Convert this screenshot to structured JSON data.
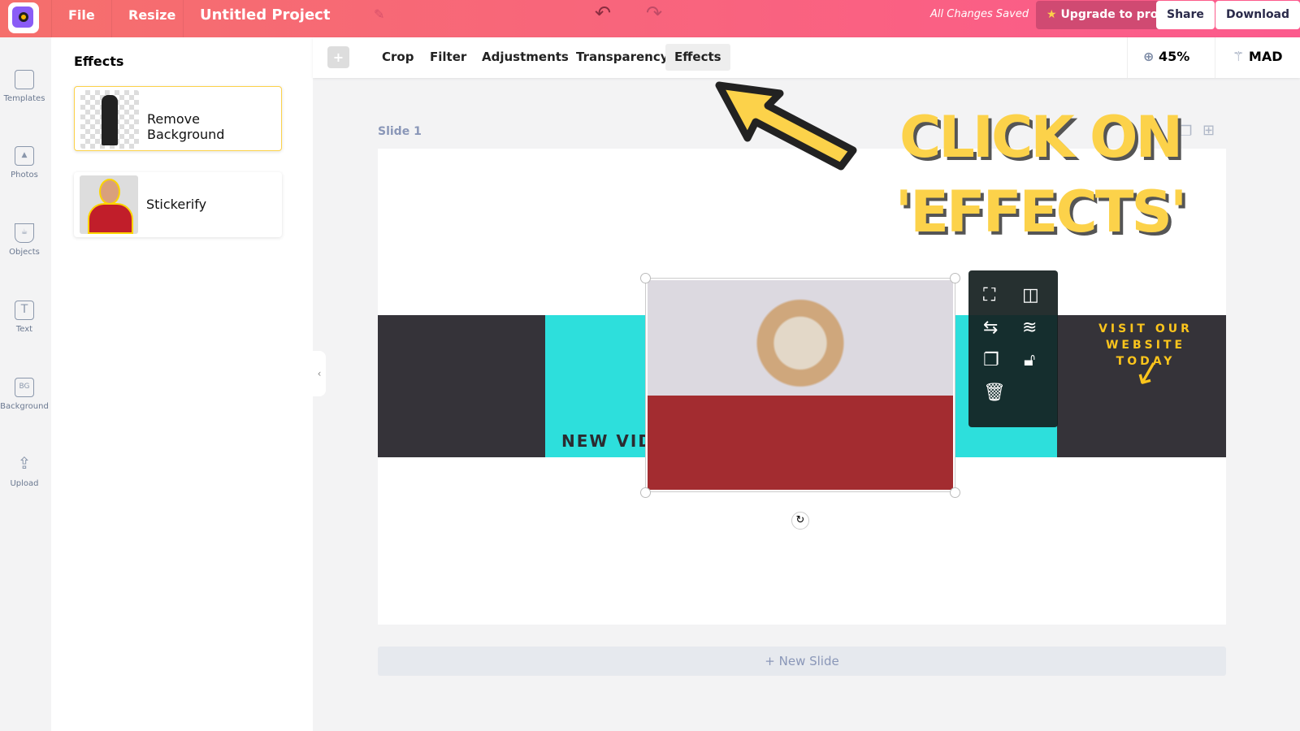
{
  "topbar": {
    "file": "File",
    "resize": "Resize",
    "project_title": "Untitled Project",
    "status": "All Changes Saved",
    "upgrade": "Upgrade to pro",
    "share": "Share",
    "download": "Download"
  },
  "sidebar": {
    "items": [
      {
        "label": "Templates"
      },
      {
        "label": "Photos"
      },
      {
        "label": "Objects"
      },
      {
        "label": "Text"
      },
      {
        "label": "Background",
        "icon_text": "BG"
      },
      {
        "label": "Upload"
      }
    ]
  },
  "panel": {
    "title": "Effects",
    "cards": [
      {
        "label": "Remove Background"
      },
      {
        "label": "Stickerify"
      }
    ]
  },
  "toolbar": {
    "items": [
      "Crop",
      "Filter",
      "Adjustments",
      "Transparency",
      "Effects"
    ],
    "active": "Effects",
    "zoom": "45%",
    "magic": "MAD"
  },
  "slide": {
    "label": "Slide 1",
    "banner_left": "NEW VIDE",
    "banner_right": "VISIT OUR WEBSITE TODAY",
    "annotation_line1": "CLICK ON",
    "annotation_line2": "'EFFECTS'",
    "new_slide": "+ New Slide"
  },
  "colors": {
    "accent": "#fc5a8d",
    "cyan": "#2ddfdc",
    "dark": "#353339",
    "yellow": "#fcd24a"
  }
}
